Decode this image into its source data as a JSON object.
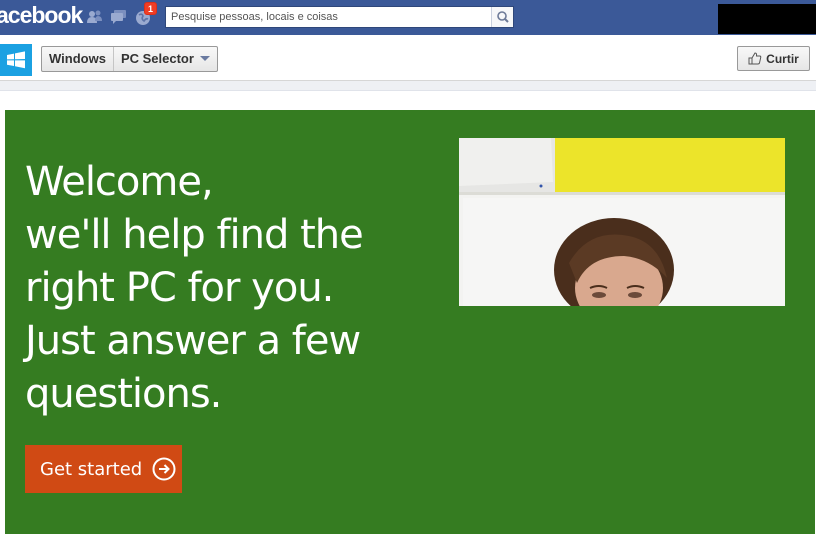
{
  "topbar": {
    "logo_text": "acebook",
    "notification_count": "1",
    "search_placeholder": "Pesquise pessoas, locais e coisas",
    "icons": [
      "friends-icon",
      "messages-icon",
      "globe-notifications-icon",
      "search-icon"
    ],
    "brand_color": "#3b5998"
  },
  "page_header": {
    "breadcrumb": [
      "Windows",
      "PC Selector"
    ],
    "like_label": "Curtir"
  },
  "hero": {
    "lines": [
      "Welcome,",
      "we'll help find the",
      "right PC for you.",
      "Just answer a few",
      "questions."
    ],
    "cta_label": "Get started",
    "background_color": "#357c21",
    "cta_color": "#d04a14"
  }
}
